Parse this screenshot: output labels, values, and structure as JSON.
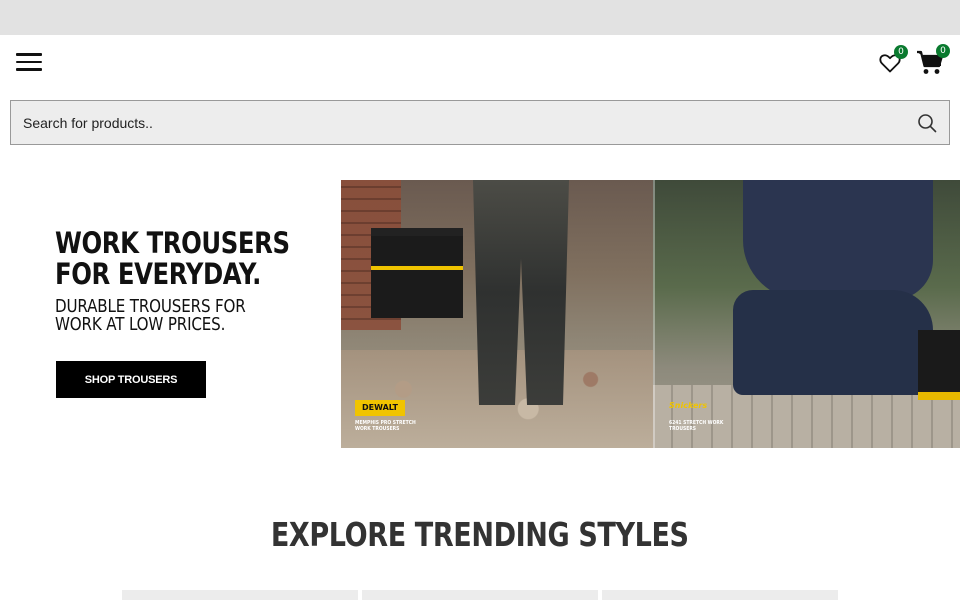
{
  "header": {
    "wishlist_count": "0",
    "cart_count": "0"
  },
  "search": {
    "placeholder": "Search for products.."
  },
  "hero": {
    "title_line1": "WORK TROUSERS",
    "title_line2": "FOR EVERYDAY.",
    "subtitle_line1": "DURABLE TROUSERS FOR",
    "subtitle_line2": "WORK AT LOW PRICES.",
    "cta_label": "SHOP TROUSERS",
    "image": {
      "left_brand": "DEWALT",
      "left_caption": "MEMPHIS PRO STRETCH WORK TROUSERS",
      "right_brand": "Snickers",
      "right_caption": "6241 STRETCH WORK TROUSERS"
    }
  },
  "trending": {
    "title": "EXPLORE TRENDING STYLES"
  },
  "colors": {
    "badge": "#0a7a2f",
    "cta_background": "#000000",
    "topbar": "#e2e2e2"
  },
  "icons": [
    "menu-icon",
    "heart-icon",
    "cart-icon",
    "search-icon"
  ]
}
